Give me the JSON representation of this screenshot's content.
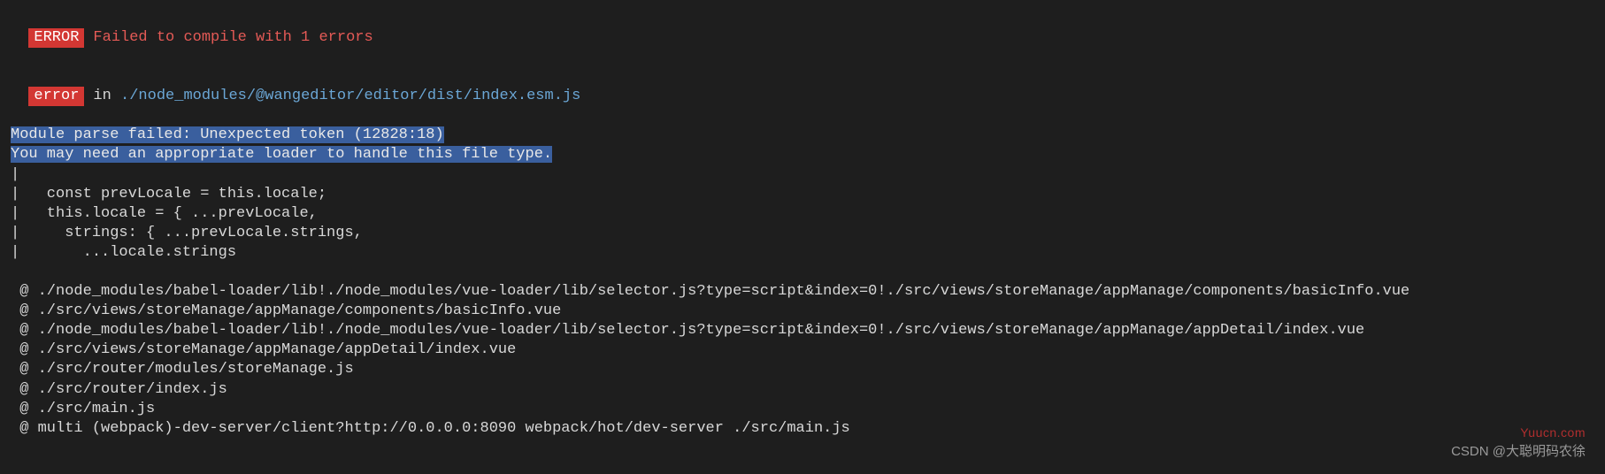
{
  "header": {
    "badge": "ERROR",
    "message": "Failed to compile with 1 errors"
  },
  "errorLine": {
    "badge": "error",
    "prefix": "in ",
    "path": "./node_modules/@wangeditor/editor/dist/index.esm.js"
  },
  "moduleError": {
    "line1": "Module parse failed: Unexpected token (12828:18)",
    "line2": "You may need an appropriate loader to handle this file type."
  },
  "code": [
    "|",
    "|   const prevLocale = this.locale;",
    "|   this.locale = { ...prevLocale,",
    "|     strings: { ...prevLocale.strings,",
    "|       ...locale.strings"
  ],
  "stack": [
    " @ ./node_modules/babel-loader/lib!./node_modules/vue-loader/lib/selector.js?type=script&index=0!./src/views/storeManage/appManage/components/basicInfo.vue",
    " @ ./src/views/storeManage/appManage/components/basicInfo.vue",
    " @ ./node_modules/babel-loader/lib!./node_modules/vue-loader/lib/selector.js?type=script&index=0!./src/views/storeManage/appManage/appDetail/index.vue",
    " @ ./src/views/storeManage/appManage/appDetail/index.vue",
    " @ ./src/router/modules/storeManage.js",
    " @ ./src/router/index.js",
    " @ ./src/main.js",
    " @ multi (webpack)-dev-server/client?http://0.0.0.0:8090 webpack/hot/dev-server ./src/main.js"
  ],
  "watermarks": {
    "site": "Yuucn.com",
    "author": "CSDN @大聪明码农徐"
  }
}
